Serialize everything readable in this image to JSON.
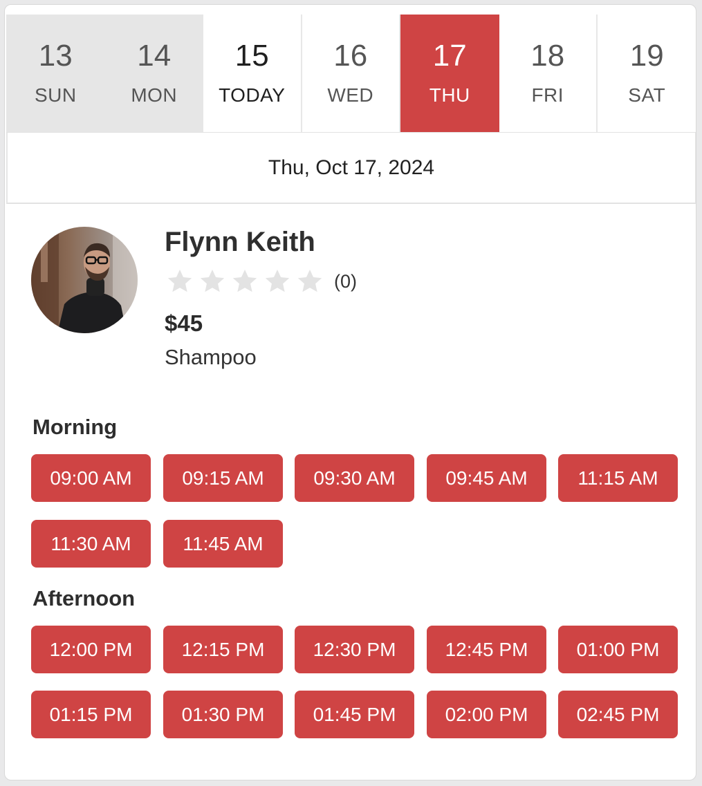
{
  "colors": {
    "accent": "#cf4444",
    "past_bg": "#e6e6e6",
    "star_empty": "#e3e3e3"
  },
  "week": [
    {
      "num": "13",
      "label": "SUN",
      "state": "past"
    },
    {
      "num": "14",
      "label": "MON",
      "state": "past"
    },
    {
      "num": "15",
      "label": "TODAY",
      "state": "today"
    },
    {
      "num": "16",
      "label": "WED",
      "state": "future"
    },
    {
      "num": "17",
      "label": "THU",
      "state": "selected"
    },
    {
      "num": "18",
      "label": "FRI",
      "state": "future"
    },
    {
      "num": "19",
      "label": "SAT",
      "state": "future"
    }
  ],
  "selected_date": "Thu, Oct 17, 2024",
  "provider": {
    "name": "Flynn Keith",
    "rating_stars": 0,
    "rating_max": 5,
    "rating_count": "(0)",
    "price": "$45",
    "service": "Shampoo"
  },
  "sections": {
    "morning": {
      "title": "Morning",
      "slots": [
        "09:00 AM",
        "09:15 AM",
        "09:30 AM",
        "09:45 AM",
        "11:15 AM",
        "11:30 AM",
        "11:45 AM"
      ]
    },
    "afternoon": {
      "title": "Afternoon",
      "slots": [
        "12:00 PM",
        "12:15 PM",
        "12:30 PM",
        "12:45 PM",
        "01:00 PM",
        "01:15 PM",
        "01:30 PM",
        "01:45 PM",
        "02:00 PM",
        "02:45 PM"
      ]
    }
  }
}
